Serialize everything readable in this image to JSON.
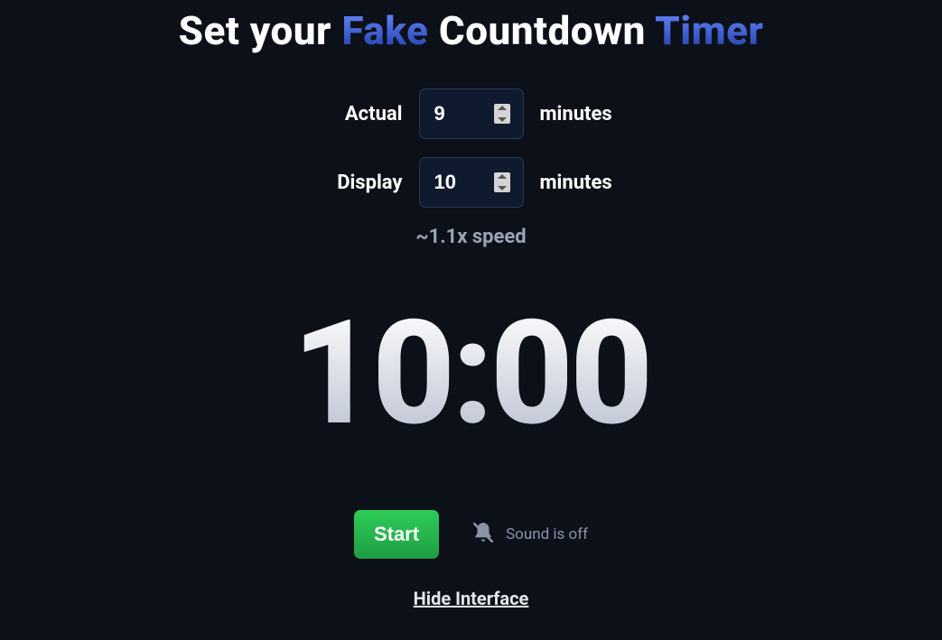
{
  "heading": {
    "part1": "Set your ",
    "accent1": "Fake",
    "part2": " Countdown ",
    "accent2": "Timer"
  },
  "form": {
    "actual": {
      "label": "Actual",
      "value": "9",
      "unit": "minutes"
    },
    "display": {
      "label": "Display",
      "value": "10",
      "unit": "minutes"
    }
  },
  "speed_text": "~1.1x speed",
  "timer_display": "10:00",
  "controls": {
    "start_label": "Start",
    "sound_label": "Sound is off"
  },
  "hide_interface_label": "Hide Interface"
}
